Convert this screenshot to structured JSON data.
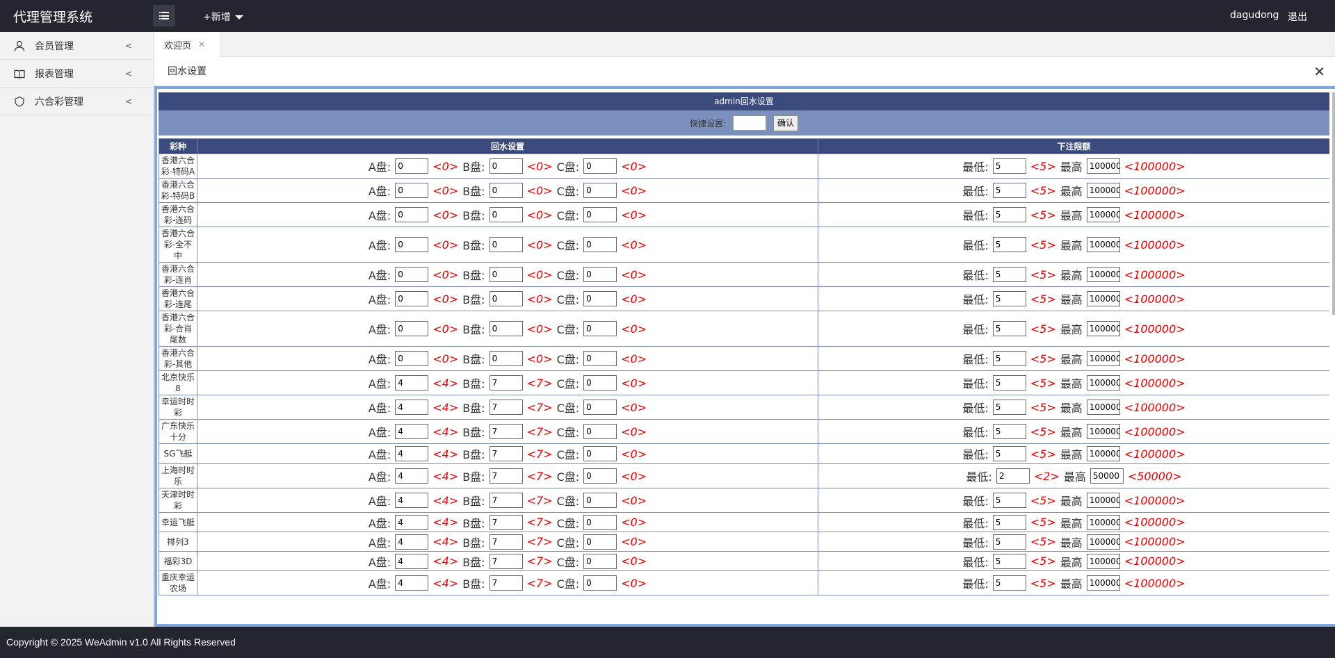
{
  "app": {
    "title": "代理管理系统",
    "add_new": "+新增",
    "username": "dagudong",
    "logout": "退出"
  },
  "sidebar": {
    "items": [
      {
        "label": "会员管理",
        "icon": "user-icon"
      },
      {
        "label": "报表管理",
        "icon": "book-icon"
      },
      {
        "label": "六合彩管理",
        "icon": "shield-icon"
      }
    ]
  },
  "tabs": [
    {
      "label": "欢迎页"
    }
  ],
  "dialog": {
    "title": "回水设置"
  },
  "panel": {
    "title": "admin回水设置",
    "quick_label": "快捷设置:",
    "quick_value": "",
    "confirm": "确认",
    "col_game": "彩种",
    "col_rebate": "回水设置",
    "col_limit": "下注限额",
    "a_label": "A盘:",
    "b_label": "B盘:",
    "c_label": "C盘:",
    "min_label": "最低:",
    "max_label": "最高"
  },
  "rows": [
    {
      "game": "香港六合彩-特码A",
      "a": "0",
      "b": "0",
      "c": "0",
      "a_hint": "<0>",
      "b_hint": "<0>",
      "c_hint": "<0>",
      "min": "5",
      "min_hint": "<5>",
      "max": "100000",
      "max_hint": "<100000>"
    },
    {
      "game": "香港六合彩-特码B",
      "a": "0",
      "b": "0",
      "c": "0",
      "a_hint": "<0>",
      "b_hint": "<0>",
      "c_hint": "<0>",
      "min": "5",
      "min_hint": "<5>",
      "max": "100000",
      "max_hint": "<100000>"
    },
    {
      "game": "香港六合彩-连码",
      "a": "0",
      "b": "0",
      "c": "0",
      "a_hint": "<0>",
      "b_hint": "<0>",
      "c_hint": "<0>",
      "min": "5",
      "min_hint": "<5>",
      "max": "100000",
      "max_hint": "<100000>"
    },
    {
      "game": "香港六合彩-全不中",
      "a": "0",
      "b": "0",
      "c": "0",
      "a_hint": "<0>",
      "b_hint": "<0>",
      "c_hint": "<0>",
      "min": "5",
      "min_hint": "<5>",
      "max": "100000",
      "max_hint": "<100000>"
    },
    {
      "game": "香港六合彩-连肖",
      "a": "0",
      "b": "0",
      "c": "0",
      "a_hint": "<0>",
      "b_hint": "<0>",
      "c_hint": "<0>",
      "min": "5",
      "min_hint": "<5>",
      "max": "100000",
      "max_hint": "<100000>"
    },
    {
      "game": "香港六合彩-连尾",
      "a": "0",
      "b": "0",
      "c": "0",
      "a_hint": "<0>",
      "b_hint": "<0>",
      "c_hint": "<0>",
      "min": "5",
      "min_hint": "<5>",
      "max": "100000",
      "max_hint": "<100000>"
    },
    {
      "game": "香港六合彩-合肖尾数",
      "a": "0",
      "b": "0",
      "c": "0",
      "a_hint": "<0>",
      "b_hint": "<0>",
      "c_hint": "<0>",
      "min": "5",
      "min_hint": "<5>",
      "max": "100000",
      "max_hint": "<100000>"
    },
    {
      "game": "香港六合彩-其他",
      "a": "0",
      "b": "0",
      "c": "0",
      "a_hint": "<0>",
      "b_hint": "<0>",
      "c_hint": "<0>",
      "min": "5",
      "min_hint": "<5>",
      "max": "100000",
      "max_hint": "<100000>"
    },
    {
      "game": "北京快乐8",
      "a": "4",
      "b": "7",
      "c": "0",
      "a_hint": "<4>",
      "b_hint": "<7>",
      "c_hint": "<0>",
      "min": "5",
      "min_hint": "<5>",
      "max": "100000",
      "max_hint": "<100000>"
    },
    {
      "game": "幸运时时彩",
      "a": "4",
      "b": "7",
      "c": "0",
      "a_hint": "<4>",
      "b_hint": "<7>",
      "c_hint": "<0>",
      "min": "5",
      "min_hint": "<5>",
      "max": "100000",
      "max_hint": "<100000>"
    },
    {
      "game": "广东快乐十分",
      "a": "4",
      "b": "7",
      "c": "0",
      "a_hint": "<4>",
      "b_hint": "<7>",
      "c_hint": "<0>",
      "min": "5",
      "min_hint": "<5>",
      "max": "100000",
      "max_hint": "<100000>"
    },
    {
      "game": "SG飞艇",
      "a": "4",
      "b": "7",
      "c": "0",
      "a_hint": "<4>",
      "b_hint": "<7>",
      "c_hint": "<0>",
      "min": "5",
      "min_hint": "<5>",
      "max": "100000",
      "max_hint": "<100000>"
    },
    {
      "game": "上海时时乐",
      "a": "4",
      "b": "7",
      "c": "0",
      "a_hint": "<4>",
      "b_hint": "<7>",
      "c_hint": "<0>",
      "min": "2",
      "min_hint": "<2>",
      "max": "50000",
      "max_hint": "<50000>"
    },
    {
      "game": "天津时时彩",
      "a": "4",
      "b": "7",
      "c": "0",
      "a_hint": "<4>",
      "b_hint": "<7>",
      "c_hint": "<0>",
      "min": "5",
      "min_hint": "<5>",
      "max": "100000",
      "max_hint": "<100000>"
    },
    {
      "game": "幸运飞艇",
      "a": "4",
      "b": "7",
      "c": "0",
      "a_hint": "<4>",
      "b_hint": "<7>",
      "c_hint": "<0>",
      "min": "5",
      "min_hint": "<5>",
      "max": "100000",
      "max_hint": "<100000>"
    },
    {
      "game": "排列3",
      "a": "4",
      "b": "7",
      "c": "0",
      "a_hint": "<4>",
      "b_hint": "<7>",
      "c_hint": "<0>",
      "min": "5",
      "min_hint": "<5>",
      "max": "100000",
      "max_hint": "<100000>"
    },
    {
      "game": "福彩3D",
      "a": "4",
      "b": "7",
      "c": "0",
      "a_hint": "<4>",
      "b_hint": "<7>",
      "c_hint": "<0>",
      "min": "5",
      "min_hint": "<5>",
      "max": "100000",
      "max_hint": "<100000>"
    },
    {
      "game": "重庆幸运农场",
      "a": "4",
      "b": "7",
      "c": "0",
      "a_hint": "<4>",
      "b_hint": "<7>",
      "c_hint": "<0>",
      "min": "5",
      "min_hint": "<5>",
      "max": "100000",
      "max_hint": "<100000>"
    }
  ],
  "footer": {
    "text": "Copyright © 2025 WeAdmin v1.0 All Rights Reserved"
  },
  "colors": {
    "topbar": "#23262e",
    "table_header": "#3b4a7d",
    "quick_bar": "#7b90bd",
    "hint_red": "#ee0000",
    "frame_border": "#7fa6dd"
  }
}
